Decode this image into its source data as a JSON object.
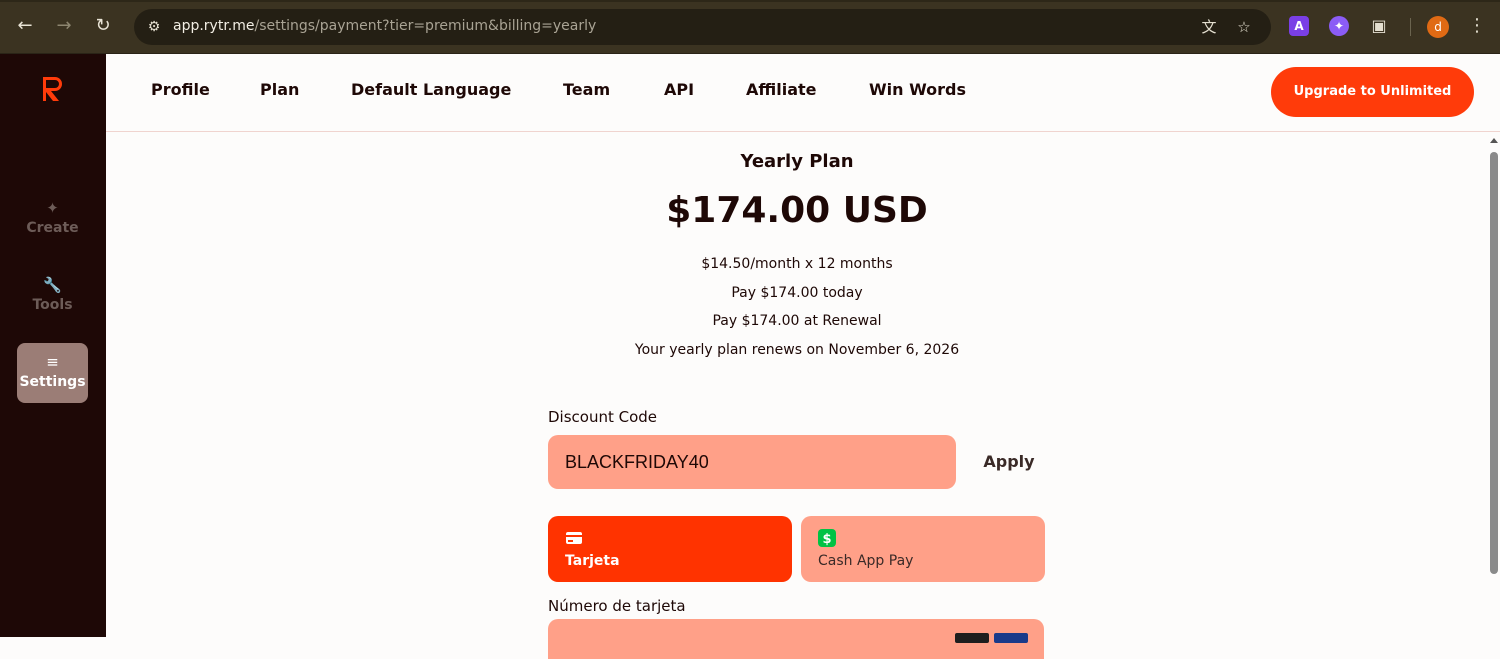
{
  "browser": {
    "url_host": "app.rytr.me",
    "url_path": "/settings/payment?tier=premium&billing=yearly",
    "profile_initial": "d",
    "extension_a_label": "A"
  },
  "sidebar": {
    "items": [
      {
        "label": "Create",
        "icon": "sparkles-icon"
      },
      {
        "label": "Tools",
        "icon": "wrench-icon"
      },
      {
        "label": "Settings",
        "icon": "sliders-icon"
      }
    ]
  },
  "topnav": {
    "tabs": [
      "Profile",
      "Plan",
      "Default Language",
      "Team",
      "API",
      "Affiliate",
      "Win Words"
    ],
    "upgrade_label": "Upgrade to Unlimited"
  },
  "plan": {
    "title": "Yearly Plan",
    "price": "$174.00 USD",
    "per_month": "$14.50/month x 12 months",
    "pay_today": "Pay $174.00 today",
    "pay_renewal": "Pay $174.00 at Renewal",
    "renews": "Your yearly plan renews on November 6, 2026"
  },
  "discount": {
    "label": "Discount Code",
    "value": "BLACKFRIDAY40",
    "apply_label": "Apply"
  },
  "payment": {
    "methods": [
      {
        "label": "Tarjeta",
        "icon": "credit-card-icon"
      },
      {
        "label": "Cash App Pay",
        "icon": "cash-app-icon"
      }
    ],
    "card_number_label": "Número de tarjeta"
  },
  "colors": {
    "brand": "#ff3300",
    "brand_light": "#ffa088",
    "sidebar_bg": "#1e0806",
    "sidebar_active": "#9b7d76"
  }
}
